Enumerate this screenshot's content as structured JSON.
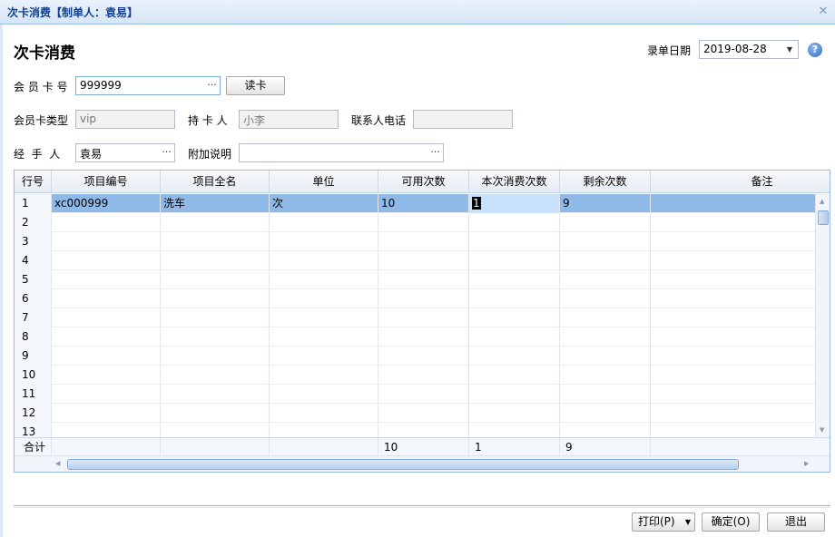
{
  "window": {
    "title": "次卡消费【制单人：袁易】",
    "close_glyph": "✕"
  },
  "heading": "次卡消费",
  "date": {
    "label": "录单日期",
    "value": "2019-08-28",
    "dropdown_glyph": "▼"
  },
  "help_glyph": "?",
  "form": {
    "card_no_label": "会 员 卡 号",
    "card_no_value": "999999",
    "read_card_button": "读卡",
    "card_type_label": "会员卡类型",
    "card_type_value": "vip",
    "holder_label": "持 卡 人",
    "holder_value": "小李",
    "contact_label": "联系人电话",
    "contact_value": "",
    "handler_label": "经  手  人",
    "handler_value": "袁易",
    "note_label": "附加说明",
    "note_value": "",
    "trigger_glyph": "···"
  },
  "grid": {
    "columns": [
      "行号",
      "项目编号",
      "项目全名",
      "单位",
      "可用次数",
      "本次消费次数",
      "剩余次数",
      "备注"
    ],
    "rows": [
      {
        "no": "1",
        "code": "xc000999",
        "name": "洗车",
        "unit": "次",
        "available": "10",
        "used": "1",
        "remaining": "9",
        "remark": ""
      },
      {
        "no": "2"
      },
      {
        "no": "3"
      },
      {
        "no": "4"
      },
      {
        "no": "5"
      },
      {
        "no": "6"
      },
      {
        "no": "7"
      },
      {
        "no": "8"
      },
      {
        "no": "9"
      },
      {
        "no": "10"
      },
      {
        "no": "11"
      },
      {
        "no": "12"
      },
      {
        "no": "13"
      }
    ],
    "total": {
      "label": "合计",
      "available": "10",
      "used": "1",
      "remaining": "9"
    }
  },
  "buttons": {
    "print": "打印(P)",
    "confirm": "确定(O)",
    "exit": "退出"
  },
  "colors": {
    "selected_row": "#8fb9e6",
    "title": "#15428b"
  }
}
